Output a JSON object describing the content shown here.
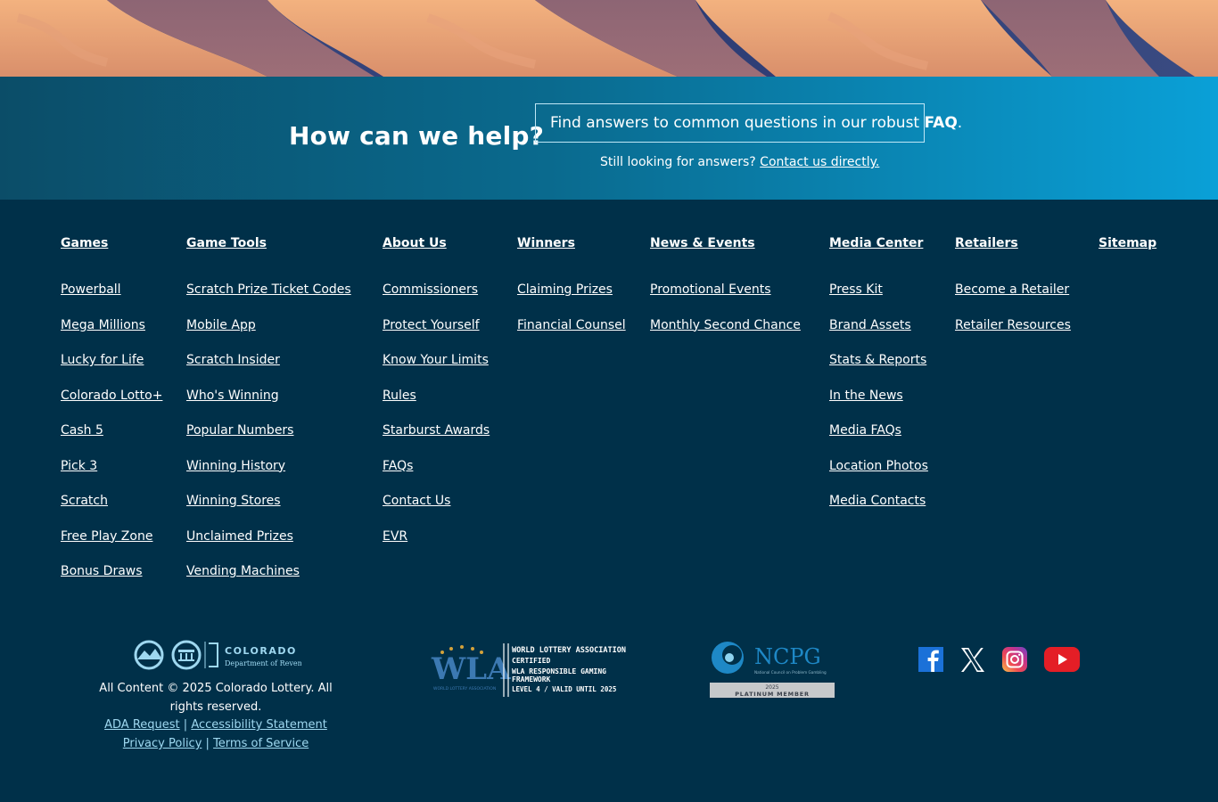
{
  "help": {
    "title": "How can we help?",
    "faq_prefix": "Find answers to common questions in our robust",
    "faq_link": "FAQ",
    "faq_suffix": ".",
    "still_text": "Still looking for answers?",
    "contact_link": "Contact us directly."
  },
  "nav": [
    {
      "heading": "Games",
      "items": [
        "Powerball",
        "Mega Millions",
        "Lucky for Life",
        "Colorado Lotto+",
        "Cash 5",
        "Pick 3",
        "Scratch",
        "Free Play Zone",
        "Bonus Draws"
      ]
    },
    {
      "heading": "Game Tools",
      "items": [
        "Scratch Prize Ticket Codes",
        "Mobile App",
        "Scratch Insider",
        "Who's Winning",
        "Popular Numbers",
        "Winning History",
        "Winning Stores",
        "Unclaimed Prizes",
        "Vending Machines"
      ]
    },
    {
      "heading": "About Us",
      "items": [
        "Commissioners",
        "Protect Yourself",
        "Know Your Limits",
        "Rules",
        "Starburst Awards",
        "FAQs",
        "Contact Us",
        "EVR"
      ]
    },
    {
      "heading": "Winners",
      "items": [
        "Claiming Prizes",
        "Financial Counsel"
      ]
    },
    {
      "heading": "News & Events",
      "items": [
        "Promotional Events",
        "Monthly Second Chance"
      ]
    },
    {
      "heading": "Media Center",
      "items": [
        "Press Kit",
        "Brand Assets",
        "Stats & Reports",
        "In the News",
        "Media FAQs",
        "Location Photos",
        "Media Contacts"
      ]
    },
    {
      "heading": "Retailers",
      "items": [
        "Become a Retailer",
        "Retailer Resources"
      ]
    },
    {
      "heading": "Sitemap",
      "items": []
    }
  ],
  "footer": {
    "colorado_logo": {
      "org": "COLORADO",
      "dept": "Department of Revenue"
    },
    "copyright": "All Content © 2025 Colorado Lottery. All rights reserved.",
    "links_row1": [
      "ADA Request",
      "Accessibility Statement"
    ],
    "links_row2": [
      "Privacy Policy",
      "Terms of Service"
    ],
    "separator": "|",
    "wla": {
      "mark": "WLA",
      "mark_sub": "WORLD LOTTERY ASSOCIATION",
      "line1": "WORLD LOTTERY ASSOCIATION",
      "line2": "CERTIFIED",
      "line3": "WLA RESPONSIBLE GAMING",
      "line4": "FRAMEWORK",
      "line5": "LEVEL 4 / VALID UNTIL 2025"
    },
    "ncpg": {
      "mark": "NCPG",
      "sub": "National Council on Problem Gambling",
      "year": "2025",
      "member": "PLATINUM MEMBER"
    },
    "social": [
      "facebook",
      "x",
      "instagram",
      "youtube"
    ]
  },
  "colors": {
    "footer_bg": "#003049",
    "accent_light": "#9fd8f0",
    "help_gradient_end": "#0aa0d7"
  }
}
